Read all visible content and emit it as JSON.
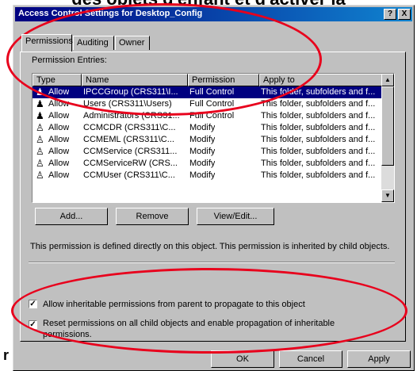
{
  "background": {
    "top_text": "des objets d'enfant et d'activer la",
    "left_mark": "r"
  },
  "window": {
    "title": "Access Control Settings for Desktop_Config",
    "help_button": "?",
    "close_button": "X"
  },
  "tabs": [
    {
      "label": "Permissions",
      "active": true
    },
    {
      "label": "Auditing",
      "active": false
    },
    {
      "label": "Owner",
      "active": false
    }
  ],
  "permissions": {
    "entries_label": "Permission Entries:",
    "columns": [
      "Type",
      "Name",
      "Permission",
      "Apply to"
    ],
    "rows": [
      {
        "type": "Allow",
        "name": "IPCCGroup (CRS311\\I...",
        "permission": "Full Control",
        "apply_to": "This folder, subfolders and f...",
        "selected": true,
        "icon": "group-icon"
      },
      {
        "type": "Allow",
        "name": "Users (CRS311\\Users)",
        "permission": "Full Control",
        "apply_to": "This folder, subfolders and f...",
        "selected": false,
        "icon": "group-icon"
      },
      {
        "type": "Allow",
        "name": "Administrators (CRS31...",
        "permission": "Full Control",
        "apply_to": "This folder, subfolders and f...",
        "selected": false,
        "icon": "group-icon"
      },
      {
        "type": "Allow",
        "name": "CCMCDR (CRS311\\C...",
        "permission": "Modify",
        "apply_to": "This folder, subfolders and f...",
        "selected": false,
        "icon": "user-icon"
      },
      {
        "type": "Allow",
        "name": "CCMEML (CRS311\\C...",
        "permission": "Modify",
        "apply_to": "This folder, subfolders and f...",
        "selected": false,
        "icon": "user-icon"
      },
      {
        "type": "Allow",
        "name": "CCMService (CRS311...",
        "permission": "Modify",
        "apply_to": "This folder, subfolders and f...",
        "selected": false,
        "icon": "user-icon"
      },
      {
        "type": "Allow",
        "name": "CCMServiceRW (CRS...",
        "permission": "Modify",
        "apply_to": "This folder, subfolders and f...",
        "selected": false,
        "icon": "user-icon"
      },
      {
        "type": "Allow",
        "name": "CCMUser (CRS311\\C...",
        "permission": "Modify",
        "apply_to": "This folder, subfolders and f...",
        "selected": false,
        "icon": "user-icon"
      }
    ],
    "add_button": "Add...",
    "remove_button": "Remove",
    "view_edit_button": "View/Edit...",
    "description": "This permission is defined directly on this object. This permission is inherited by child objects.",
    "allow_inheritable": {
      "label": "Allow inheritable permissions from parent to propagate to this object",
      "checked": true
    },
    "reset_permissions": {
      "label_line1": "Reset permissions on all child objects and enable propagation of inheritable",
      "label_line2": "permissions.",
      "checked": true
    }
  },
  "footer": {
    "ok_button": "OK",
    "cancel_button": "Cancel",
    "apply_button": "Apply"
  },
  "annotation_color": "#e8001c",
  "selection_color": "#000080"
}
